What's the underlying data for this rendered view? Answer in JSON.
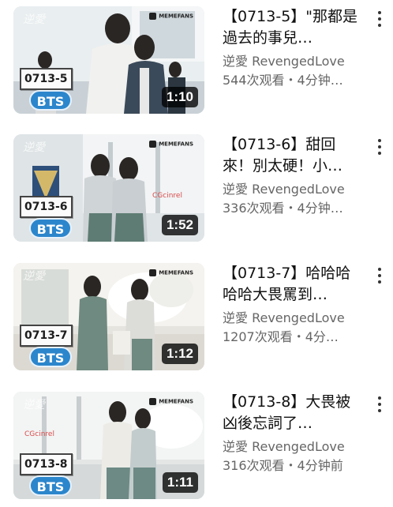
{
  "videos": [
    {
      "episode": "0713-5",
      "badge": "BTS",
      "watermark": "逆愛",
      "thumb_brand": "MEMEFANS",
      "duration": "1:10",
      "title": "【0713-5】\"那都是過去的事兒…",
      "channel": "逆愛 RevengedLove",
      "stats": "544次观看・4分钟…",
      "thumb_palette": {
        "bg": "#e9eef0",
        "wall": "#f4f6f7",
        "fig1": "#f1f1ef",
        "fig2": "#3b4a5a",
        "accent": "#b7c3cc"
      }
    },
    {
      "episode": "0713-6",
      "badge": "BTS",
      "watermark": "逆愛",
      "thumb_brand": "MEMEFANS",
      "duration": "1:52",
      "title": "【0713-6】甜回來！別太硬！小…",
      "channel": "逆愛 RevengedLove",
      "stats": "336次观看・4分钟…",
      "thumb_palette": {
        "bg": "#dfe4e6",
        "wall": "#f2f4f5",
        "fig1": "#5e7c73",
        "fig2": "#c9ced2",
        "accent": "#2d4f7a"
      }
    },
    {
      "episode": "0713-7",
      "badge": "BTS",
      "watermark": "逆愛",
      "thumb_brand": "MEMEFANS",
      "duration": "1:12",
      "title": "【0713-7】哈哈哈哈哈大畏罵到…",
      "channel": "逆愛 RevengedLove",
      "stats": "1207次观看・4分…",
      "thumb_palette": {
        "bg": "#e6e4df",
        "wall": "#f5f3ef",
        "fig1": "#6f8a80",
        "fig2": "#dcdcd8",
        "accent": "#9ea7a3"
      }
    },
    {
      "episode": "0713-8",
      "badge": "BTS",
      "watermark": "逆愛",
      "thumb_brand": "MEMEFANS",
      "duration": "1:11",
      "title": "【0713-8】大畏被凶後忘詞了…",
      "channel": "逆愛 RevengedLove",
      "stats": "316次观看・4分钟前",
      "thumb_palette": {
        "bg": "#e4e6e6",
        "wall": "#f3f4f4",
        "fig1": "#ecebe6",
        "fig2": "#6d8a85",
        "accent": "#a9b0b3"
      }
    }
  ]
}
